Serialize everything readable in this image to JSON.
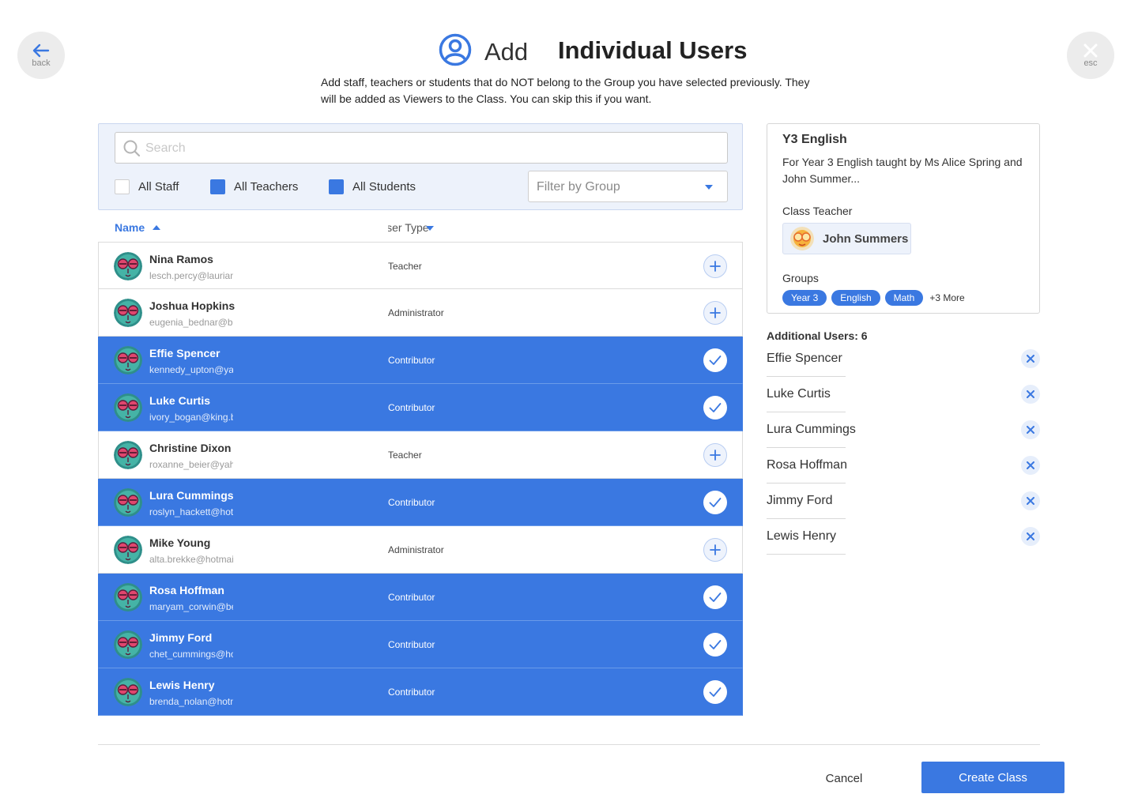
{
  "nav": {
    "back_label": "back",
    "esc_label": "esc"
  },
  "header": {
    "add_word": "Add",
    "title": "Individual Users",
    "subtitle": "Add staff, teachers or students that do NOT belong to the Group you have selected previously. They will be added as Viewers to the Class. You can skip this if you want."
  },
  "filters": {
    "search_placeholder": "Search",
    "checkboxes": [
      {
        "label": "All Staff",
        "checked": false
      },
      {
        "label": "All Teachers",
        "checked": true
      },
      {
        "label": "All Students",
        "checked": true
      }
    ],
    "group_placeholder": "Filter by Group"
  },
  "table": {
    "col_name": "Name",
    "col_type": "User Type",
    "rows": [
      {
        "name": "Nina Ramos",
        "email": "lesch.percy@laurianne.com",
        "type": "Teacher",
        "selected": false
      },
      {
        "name": "Joshua Hopkins",
        "email": "eugenia_bednar@brandi.ca",
        "type": "Administrator",
        "selected": false
      },
      {
        "name": "Effie Spencer",
        "email": "kennedy_upton@yahoo.com",
        "type": "Contributor",
        "selected": true
      },
      {
        "name": "Luke Curtis",
        "email": "ivory_bogan@king.biz",
        "type": "Contributor",
        "selected": true
      },
      {
        "name": "Christine Dixon",
        "email": "roxanne_beier@yahoo.com",
        "type": "Teacher",
        "selected": false
      },
      {
        "name": "Lura Cummings",
        "email": "roslyn_hackett@hotmail.com",
        "type": "Contributor",
        "selected": true
      },
      {
        "name": "Mike Young",
        "email": "alta.brekke@hotmail.com",
        "type": "Administrator",
        "selected": false
      },
      {
        "name": "Rosa Hoffman",
        "email": "maryam_corwin@bella.net",
        "type": "Contributor",
        "selected": true
      },
      {
        "name": "Jimmy Ford",
        "email": "chet_cummings@hotmail.com",
        "type": "Contributor",
        "selected": true
      },
      {
        "name": "Lewis Henry",
        "email": "brenda_nolan@hotmail.com",
        "type": "Contributor",
        "selected": true
      }
    ]
  },
  "class_card": {
    "title": "Y3 English",
    "description": "For Year 3 English taught by Ms Alice Spring and John Summer...",
    "teacher_label": "Class Teacher",
    "teacher_name": "John Summers",
    "groups_label": "Groups",
    "groups": [
      "Year 3",
      "English",
      "Math"
    ],
    "more_label": "+3 More"
  },
  "additional": {
    "title": "Additional Users: 6",
    "users": [
      "Effie Spencer",
      "Luke Curtis",
      "Lura Cummings",
      "Rosa Hoffman",
      "Jimmy Ford",
      "Lewis Henry"
    ]
  },
  "footer": {
    "cancel_label": "Cancel",
    "create_label": "Create Class"
  },
  "colors": {
    "accent": "#3a78e1",
    "panel": "#edf2fb"
  }
}
